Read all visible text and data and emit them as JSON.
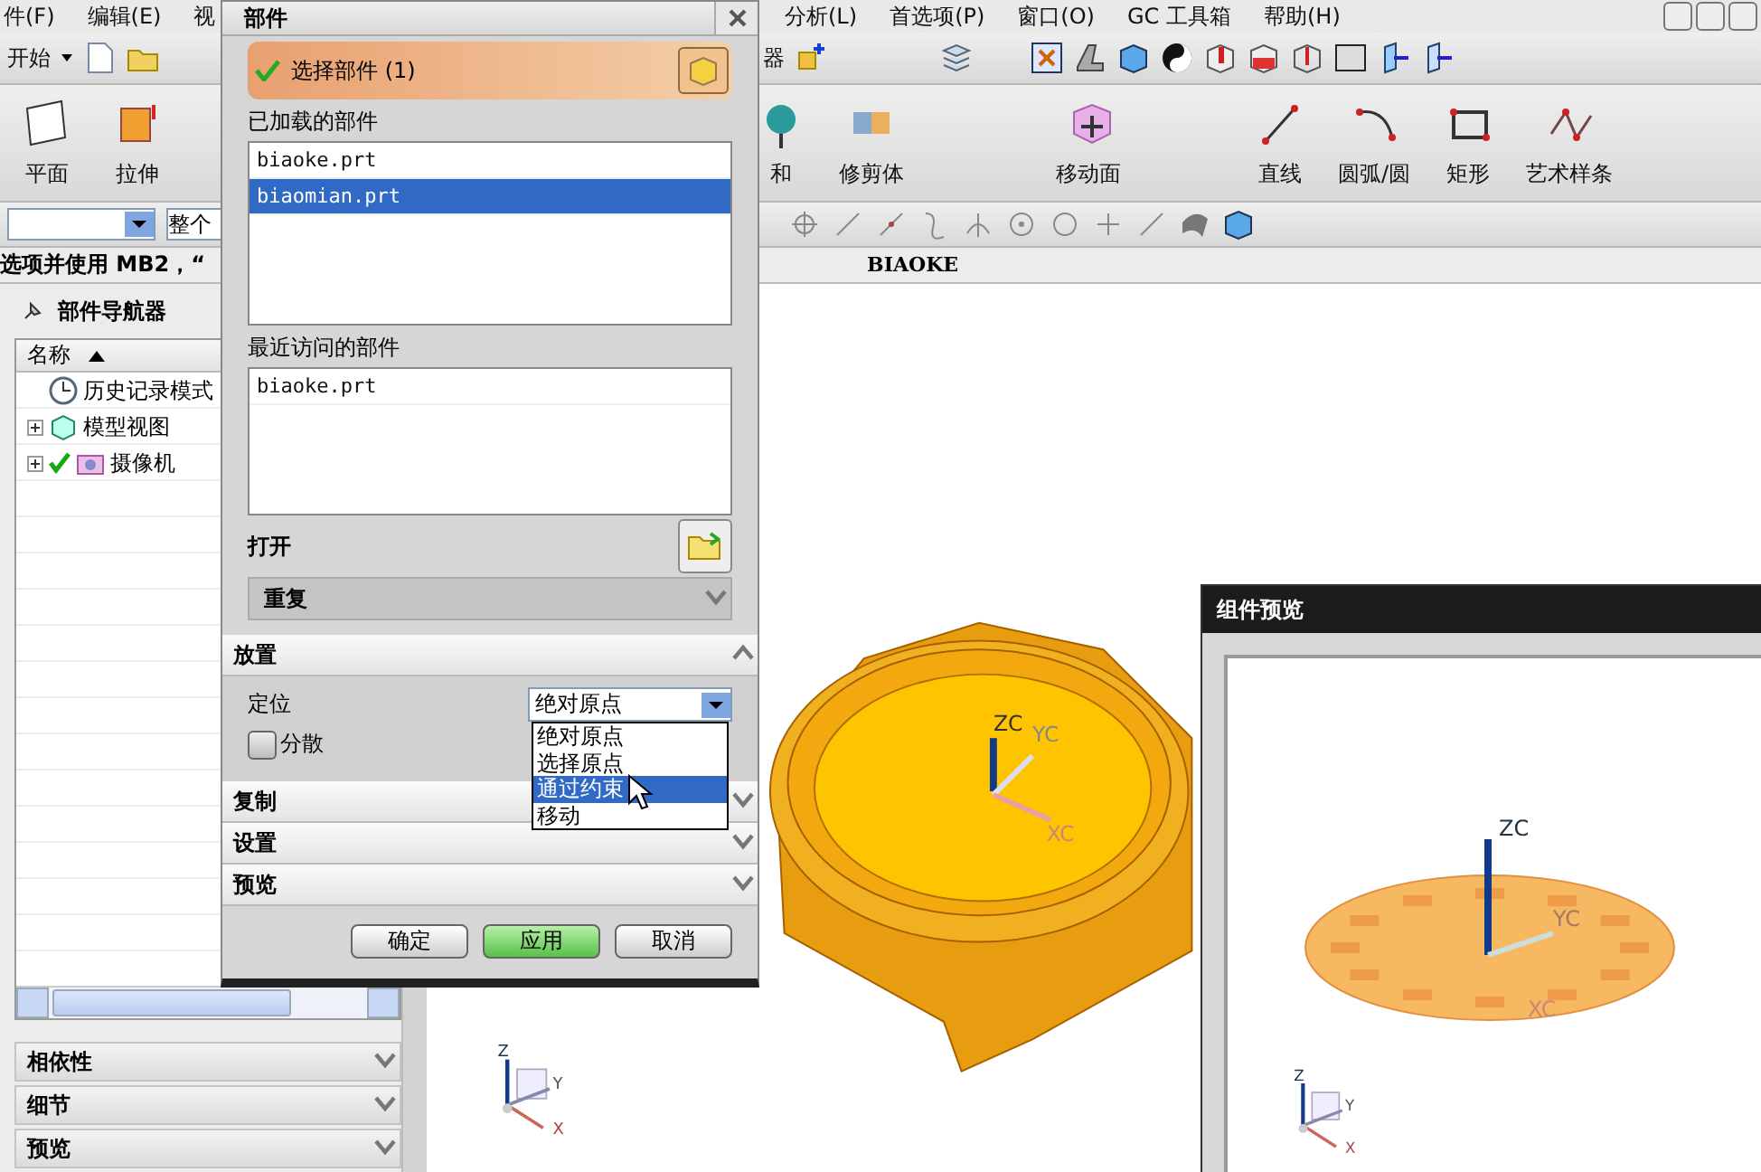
{
  "menu_bar": {
    "left": [
      "件(F)",
      "编辑(E)",
      "视"
    ],
    "right": [
      "分析(L)",
      "首选项(P)",
      "窗口(O)",
      "GC 工具箱",
      "帮助(H)"
    ]
  },
  "standard_toolbar": {
    "start_label": "开始",
    "selector_label": "器"
  },
  "feature_toolbar": {
    "left": [
      {
        "label": "平面",
        "kind": "plane"
      },
      {
        "label": "拉伸",
        "kind": "extrude"
      }
    ],
    "right": [
      {
        "label": "和",
        "kind": "unite"
      },
      {
        "label": "修剪体",
        "kind": "trim"
      },
      {
        "label": "移动面",
        "kind": "move-face"
      },
      {
        "label": "直线",
        "kind": "line"
      },
      {
        "label": "圆弧/圆",
        "kind": "arc"
      },
      {
        "label": "矩形",
        "kind": "rectangle"
      },
      {
        "label": "艺术样条",
        "kind": "spline"
      }
    ]
  },
  "filter_bar": {
    "scope_value": "整个"
  },
  "prompt": "选项并使用 MB2，“",
  "viewport": {
    "title": "BIAOKE",
    "axis_labels": [
      "ZC",
      "YC",
      "XC"
    ],
    "triad_labels": [
      "Z",
      "Y",
      "X"
    ]
  },
  "part_navigator": {
    "title": "部件导航器",
    "column": "名称",
    "sort_ascending": true,
    "tree": [
      {
        "label": "历史记录模式",
        "kind": "history",
        "expandable": false,
        "checked": false
      },
      {
        "label": "模型视图",
        "kind": "views",
        "expandable": true,
        "checked": false
      },
      {
        "label": "摄像机",
        "kind": "camera",
        "expandable": true,
        "checked": true
      }
    ],
    "panels": [
      {
        "label": "相依性",
        "expanded": false
      },
      {
        "label": "细节",
        "expanded": false
      },
      {
        "label": "预览",
        "expanded": false
      }
    ]
  },
  "dialog": {
    "title": "部件",
    "select_section": {
      "label": "选择部件 (1)",
      "complete": true
    },
    "loaded_label": "已加载的部件",
    "loaded_parts": [
      {
        "name": "biaoke.prt",
        "selected": false
      },
      {
        "name": "biaomian.prt",
        "selected": true
      }
    ],
    "recent_label": "最近访问的部件",
    "recent_parts": [
      {
        "name": "biaoke.prt",
        "selected": false
      }
    ],
    "open_label": "打开",
    "repeat": {
      "label": "重复",
      "expanded": false
    },
    "placement": {
      "label": "放置",
      "expanded": true,
      "position_label": "定位",
      "position_value": "绝对原点",
      "dropdown_open": true,
      "options": [
        {
          "label": "绝对原点",
          "selected": false
        },
        {
          "label": "选择原点",
          "selected": false
        },
        {
          "label": "通过约束",
          "selected": true
        },
        {
          "label": "移动",
          "selected": false
        }
      ],
      "scatter": {
        "label": "分散",
        "checked": false
      }
    },
    "sections": [
      {
        "label": "复制",
        "expanded": false
      },
      {
        "label": "设置",
        "expanded": false
      },
      {
        "label": "预览",
        "expanded": false
      }
    ],
    "buttons": [
      {
        "label": "确定",
        "kind": "default"
      },
      {
        "label": "应用",
        "kind": "primary"
      },
      {
        "label": "取消",
        "kind": "default"
      }
    ]
  },
  "preview_window": {
    "title": "组件预览",
    "axis_labels": [
      "ZC",
      "YC",
      "XC"
    ],
    "triad_labels": [
      "Z",
      "Y",
      "X"
    ]
  }
}
